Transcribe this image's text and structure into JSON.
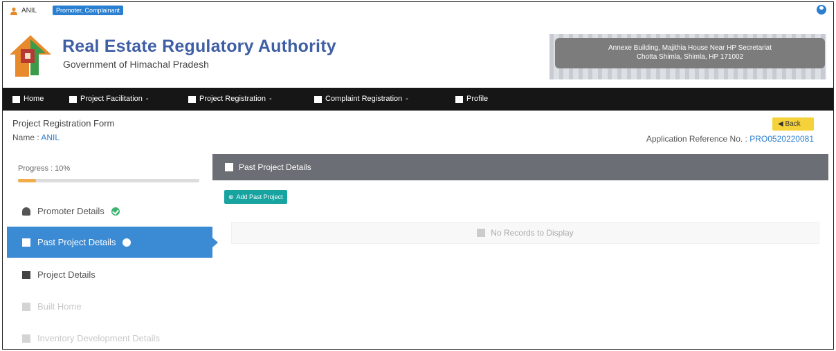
{
  "topbar": {
    "user_name": "ANIL",
    "role_badge": "Promoter, Complainant"
  },
  "header": {
    "title": "Real Estate Regulatory Authority",
    "subtitle": "Government of Himachal Pradesh",
    "address_line1": "Annexe Building, Majithia House Near HP Secretariat",
    "address_line2": "Chotta Shimla, Shimla, HP 171002"
  },
  "nav": {
    "items": [
      {
        "label": "Home",
        "icon": "home-icon"
      },
      {
        "label": "Project Facilitation",
        "icon": "facilitation-icon"
      },
      {
        "label": "Project Registration",
        "icon": "registration-icon"
      },
      {
        "label": "Complaint Registration",
        "icon": "complaint-icon"
      },
      {
        "label": "Profile",
        "icon": "profile-icon"
      }
    ],
    "dropdown_suffix": "-"
  },
  "form": {
    "title": "Project Registration Form",
    "name_label": "Name :",
    "name_value": "ANIL",
    "back_label": "Back",
    "ref_label": "Application Reference No. :",
    "ref_value": "PRO0520220081"
  },
  "sidebar": {
    "progress_label": "Progress : 10%",
    "progress": 0.1,
    "items": [
      {
        "label": "Promoter Details",
        "state": "done"
      },
      {
        "label": "Past Project Details",
        "state": "active"
      },
      {
        "label": "Project Details",
        "state": "normal"
      },
      {
        "label": "Built Home",
        "state": "disabled"
      },
      {
        "label": "Inventory Development Details",
        "state": "disabled"
      }
    ]
  },
  "main": {
    "panel_title": "Past Project Details",
    "add_button": "Add Past Project",
    "empty_message": "No Records to Display"
  },
  "colors": {
    "brand_blue": "#3f5fa5",
    "nav_bg": "#161616",
    "active_blue": "#3b8ad4",
    "panel_grey": "#6b6e74",
    "teal": "#17a3a0",
    "back_yellow": "#f6d23a"
  }
}
